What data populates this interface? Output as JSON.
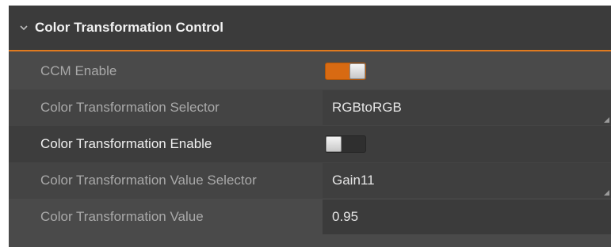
{
  "section": {
    "title": "Color Transformation Control",
    "expanded": true,
    "icon": "chevron-down-icon"
  },
  "colors": {
    "accent": "#e07a1f",
    "panel_bg": "#4a4a4a",
    "label_text": "#a9a9a9",
    "highlight_text": "#f0f0f0"
  },
  "rows": [
    {
      "label": "CCM Enable",
      "type": "toggle",
      "state": "on"
    },
    {
      "label": "Color Transformation Selector",
      "type": "dropdown",
      "value": "RGBtoRGB"
    },
    {
      "label": "Color Transformation Enable",
      "type": "toggle",
      "state": "off"
    },
    {
      "label": "Color Transformation Value Selector",
      "type": "dropdown",
      "value": "Gain11"
    },
    {
      "label": "Color Transformation Value",
      "type": "input",
      "value": "0.95"
    }
  ]
}
